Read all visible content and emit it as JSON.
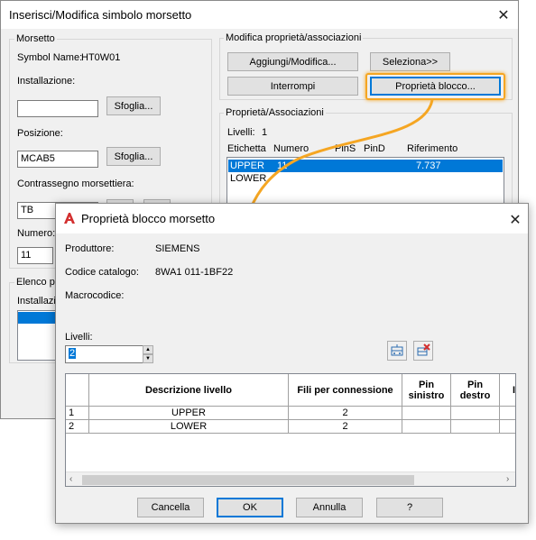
{
  "back_dialog": {
    "title": "Inserisci/Modifica simbolo morsetto",
    "morsetto_group": {
      "label": "Morsetto",
      "symbol_name_label": "Symbol Name:",
      "symbol_name_value": "HT0W01",
      "installazione_label": "Installazione:",
      "installazione_value": "",
      "sfoglia_1": "Sfoglia...",
      "posizione_label": "Posizione:",
      "posizione_value": "MCAB5",
      "sfoglia_2": "Sfoglia...",
      "contrassegno_label": "Contrassegno morsettiera:",
      "contrassegno_value": "TB",
      "numero_label": "Numero:",
      "numero_value": "11"
    },
    "elenco_group": {
      "label": "Elenco p",
      "installazione_col": "Installazio"
    },
    "modifica_group": {
      "label": "Modifica proprietà/associazioni",
      "aggiungi_btn": "Aggiungi/Modifica...",
      "seleziona_btn": "Seleziona>>",
      "interrompi_btn": "Interrompi",
      "proprieta_btn": "Proprietà blocco..."
    },
    "associazioni_group": {
      "label": "Proprietà/Associazioni",
      "livelli_label": "Livelli:",
      "livelli_value": "1",
      "columns": [
        "Etichetta",
        "Numero",
        "PinS",
        "PinD",
        "Riferimento"
      ],
      "rows": [
        {
          "etichetta": "UPPER",
          "numero": "11",
          "pins": "",
          "pind": "",
          "riferimento": "7.737"
        },
        {
          "etichetta": "LOWER",
          "numero": "",
          "pins": "",
          "pind": "",
          "riferimento": ""
        }
      ]
    }
  },
  "front_dialog": {
    "title": "Proprietà blocco morsetto",
    "produttore_label": "Produttore:",
    "produttore_value": "SIEMENS",
    "codice_label": "Codice catalogo:",
    "codice_value": "8WA1 011-1BF22",
    "macrocodice_label": "Macrocodice:",
    "macrocodice_value": "",
    "livelli_label": "Livelli:",
    "livelli_value": "2",
    "columns": [
      "Descrizione livello",
      "Fili per connessione",
      "Pin sinistro",
      "Pin destro",
      "I"
    ],
    "rows": [
      {
        "num": "1",
        "descrizione": "UPPER",
        "fili": "2",
        "pin_sx": "",
        "pin_dx": ""
      },
      {
        "num": "2",
        "descrizione": "LOWER",
        "fili": "2",
        "pin_sx": "",
        "pin_dx": ""
      }
    ],
    "buttons": {
      "cancella": "Cancella",
      "ok": "OK",
      "annulla": "Annulla",
      "help": "?"
    }
  },
  "icons": {
    "close": "close-icon",
    "app": "autocad-a-icon",
    "add_row": "add-level-icon",
    "delete_row": "delete-level-icon",
    "spin_up": "spin-up-icon",
    "spin_down": "spin-down-icon",
    "scroll_left": "scroll-left-icon",
    "scroll_right": "scroll-right-icon"
  },
  "colors": {
    "highlight": "#0078d7",
    "callout": "#f5a623",
    "app_icon": "#d32f2f"
  }
}
